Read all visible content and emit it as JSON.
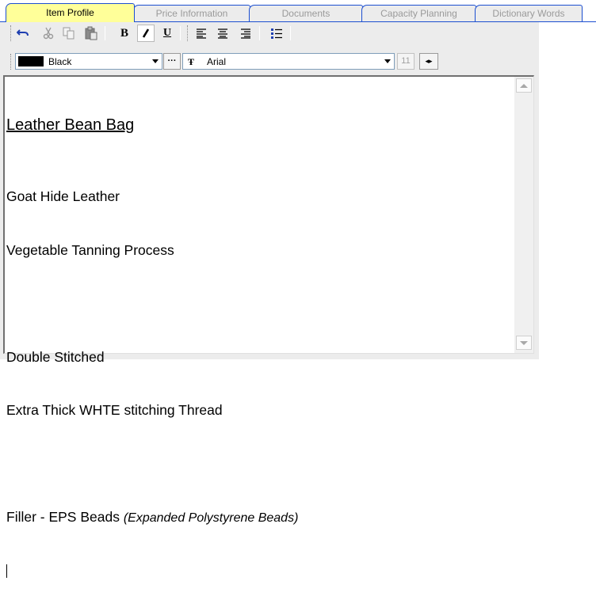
{
  "tabs": [
    {
      "label": "Item Profile",
      "active": true
    },
    {
      "label": "Price Information",
      "active": false
    },
    {
      "label": "Documents",
      "active": false
    },
    {
      "label": "Capacity Planning",
      "active": false
    },
    {
      "label": "Dictionary Words",
      "active": false
    }
  ],
  "toolbar": {
    "undo_icon": "undo-icon",
    "cut_icon": "cut-icon",
    "copy_icon": "copy-icon",
    "paste_icon": "paste-icon",
    "bold_label": "B",
    "italic_label": "I",
    "underline_label": "U",
    "align_left_icon": "align-left-icon",
    "align_center_icon": "align-center-icon",
    "align_right_icon": "align-right-icon",
    "bullets_icon": "bulleted-list-icon"
  },
  "format": {
    "color_name": "Black",
    "color_value": "#000000",
    "more_label": "···",
    "font_icon_glyph": "Ŧ",
    "font_name": "Arial",
    "font_size": "11",
    "nudge_label": "◂▸"
  },
  "document": {
    "heading": "Leather Bean Bag",
    "line1": "Goat Hide Leather",
    "line2": "Vegetable Tanning Process",
    "line3": "Double Stitched",
    "line4": "Extra Thick WHTE stitching Thread",
    "line5_main": "Filler - EPS Beads ",
    "line5_note": "(Expanded Polystyrene Beads)"
  },
  "colors": {
    "active_tab": "#ffff99",
    "tab_border": "#1c4fd0",
    "panel_bg": "#ececec"
  }
}
